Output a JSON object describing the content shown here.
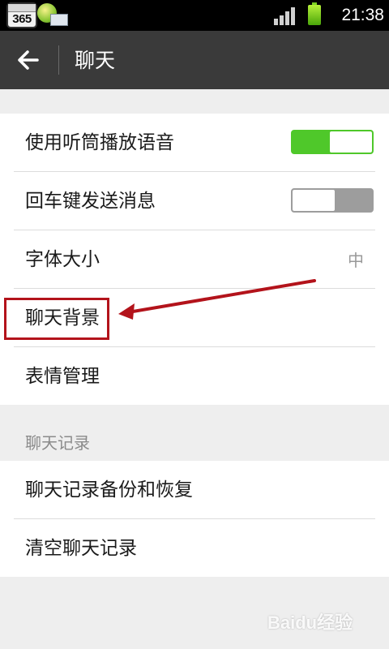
{
  "status_bar": {
    "notification_badge": "365",
    "time": "21:38"
  },
  "title_bar": {
    "back_icon": "arrow-left-icon",
    "title": "聊天"
  },
  "settings": {
    "items": [
      {
        "label": "使用听筒播放语音",
        "toggle": "on"
      },
      {
        "label": "回车键发送消息",
        "toggle": "off"
      },
      {
        "label": "字体大小",
        "value": "中"
      },
      {
        "label": "聊天背景"
      },
      {
        "label": "表情管理"
      }
    ]
  },
  "chat_history": {
    "header": "聊天记录",
    "items": [
      {
        "label": "聊天记录备份和恢复"
      },
      {
        "label": "清空聊天记录"
      }
    ]
  },
  "colors": {
    "title_bar": "#3a3a3a",
    "toggle_on": "#4fc82a",
    "toggle_off": "#9d9d9d",
    "annotation": "#b3131b"
  },
  "watermark": "Baidu经验"
}
